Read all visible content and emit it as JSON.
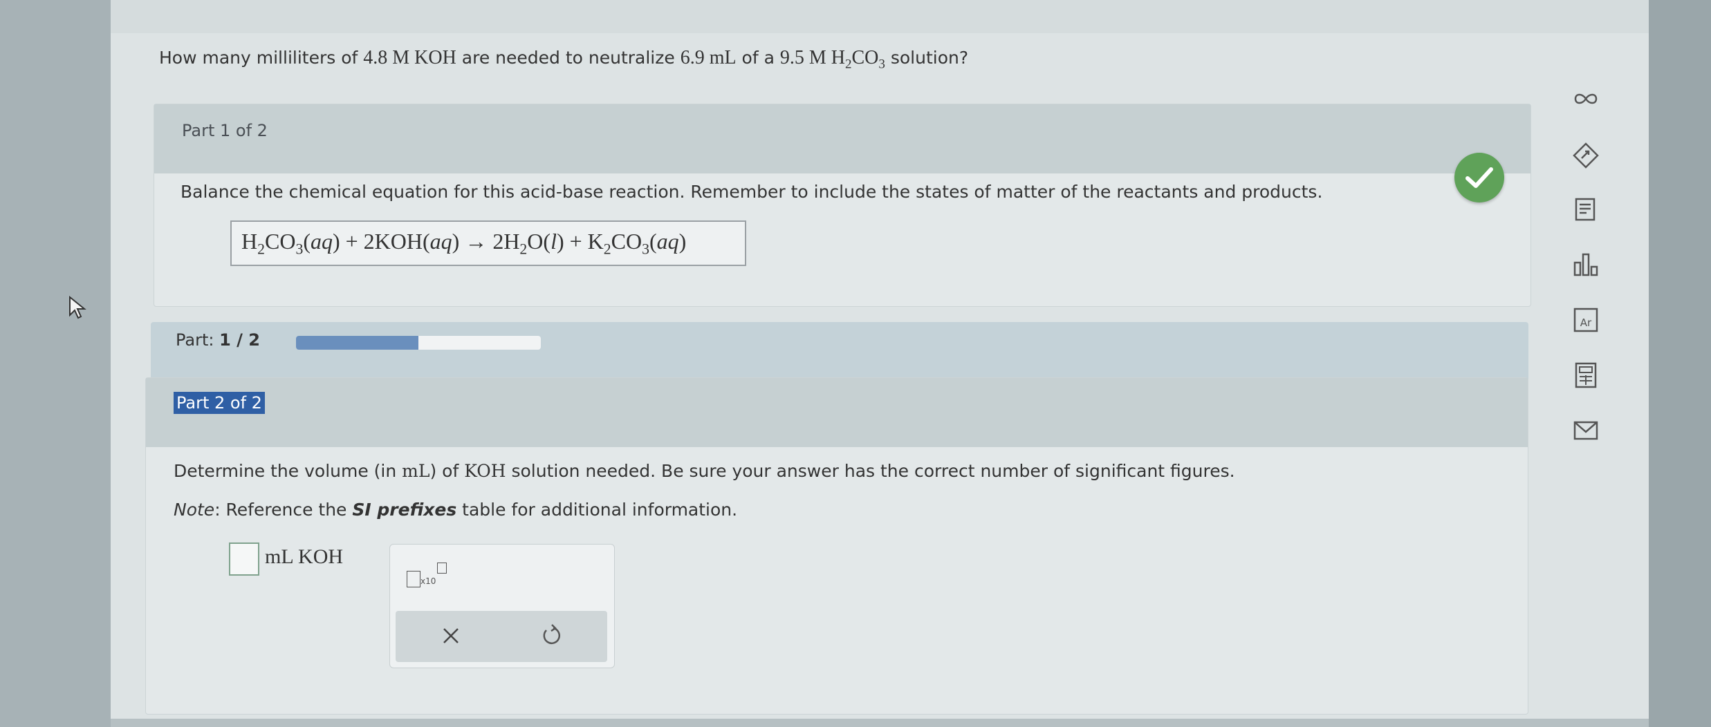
{
  "question": {
    "prefix": "How many milliliters of ",
    "koh_conc": "4.8 M KOH",
    "middle": " are needed to neutralize ",
    "volume": "6.9 mL",
    "of_a": " of a ",
    "acid_conc": "9.5 M H",
    "acid_sub1": "2",
    "acid_mid": "CO",
    "acid_sub2": "3",
    "suffix": " solution?"
  },
  "part1": {
    "title": "Part 1 of 2",
    "instruction": "Balance the chemical equation for this acid-base reaction. Remember to include the states of matter of the reactants and products.",
    "status_icon": "check-icon",
    "equation": {
      "t1": "H",
      "s1": "2",
      "t2": "CO",
      "s2": "3",
      "t3": "(",
      "st1": "aq",
      "t4": ") + 2KOH(",
      "st2": "aq",
      "t5": ") ",
      "arrow": "→",
      "t6": " 2H",
      "s3": "2",
      "t7": "O(",
      "st3": "l",
      "t8": ") + K",
      "s4": "2",
      "t9": "CO",
      "s5": "3",
      "t10": "(",
      "st4": "aq",
      "t11": ")"
    }
  },
  "progress": {
    "label": "Part: ",
    "value_text": "1 / 2",
    "fraction": 0.5
  },
  "part2": {
    "title": "Part 2 of 2",
    "instruction_a": "Determine the volume (in ",
    "instruction_unit": "mL",
    "instruction_b": ") of ",
    "instruction_koh": "KOH",
    "instruction_c": " solution needed. Be sure your answer has the correct number of significant figures.",
    "note_label": "Note",
    "note_a": ": Reference the ",
    "note_link": "SI prefixes",
    "note_b": " table for additional information.",
    "answer_value": "",
    "unit": "mL KOH",
    "sci_x10": "x10",
    "clear_icon": "close-icon",
    "reset_icon": "undo-icon"
  },
  "toolbar_icons": [
    "infinity-icon",
    "tag-icon",
    "notes-icon",
    "chart-icon",
    "periodic-table-icon",
    "calculator-icon",
    "mail-icon"
  ],
  "colors": {
    "check": "#5fa259",
    "progress": "#6a8fbd",
    "part2_highlight": "#2f5fa5"
  }
}
